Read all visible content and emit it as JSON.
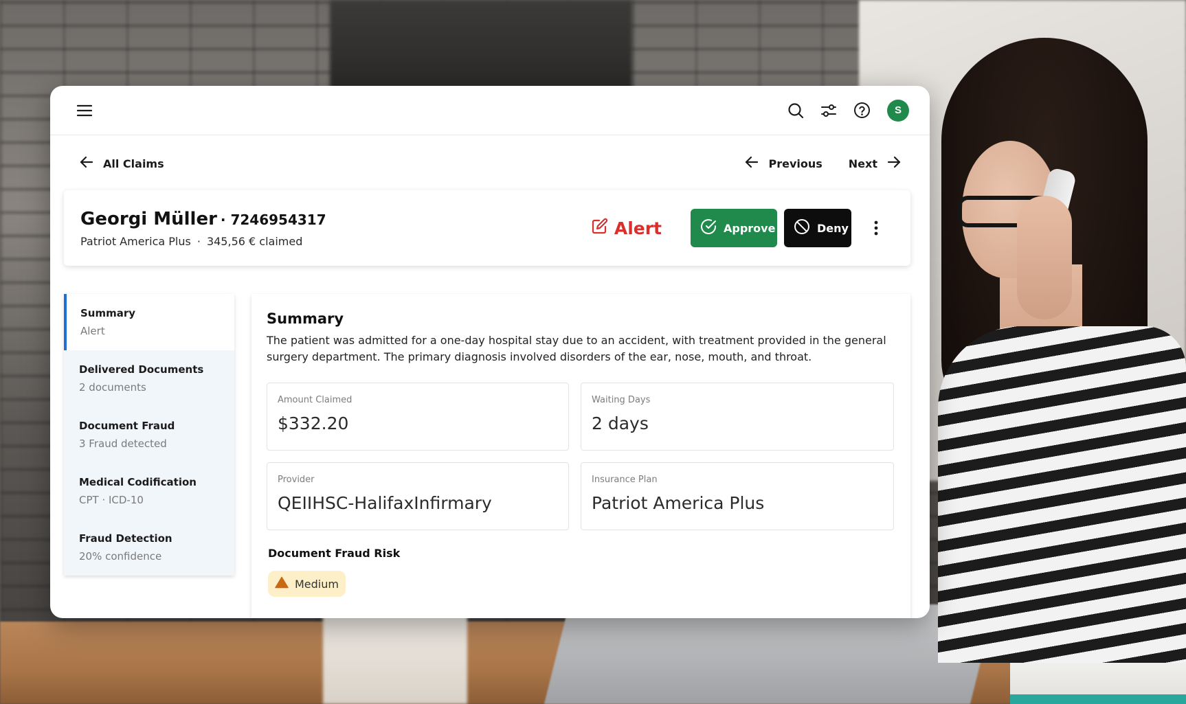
{
  "topbar": {
    "menu_icon": "menu-icon",
    "icons": [
      "search-icon",
      "filter-icon",
      "help-icon"
    ],
    "avatar_initial": "S",
    "avatar_color": "#1f8a4c"
  },
  "nav": {
    "back_label": "All Claims",
    "previous_label": "Previous",
    "next_label": "Next"
  },
  "claim": {
    "name": "Georgi Müller",
    "id": "· 7246954317",
    "plan": "Patriot America Plus",
    "separator": "·",
    "claimed": "345,56 € claimed",
    "alert_label": "Alert",
    "approve_label": "Approve",
    "deny_label": "Deny",
    "alert_color": "#d9302e",
    "approve_color": "#1f8a4c"
  },
  "sidebar": {
    "items": [
      {
        "title": "Summary",
        "subtitle": "Alert",
        "active": true
      },
      {
        "title": "Delivered Documents",
        "subtitle": "2 documents"
      },
      {
        "title": "Document Fraud",
        "subtitle": "3 Fraud detected"
      },
      {
        "title": "Medical Codification",
        "subtitle": "CPT ·  ICD-10"
      },
      {
        "title": "Fraud Detection",
        "subtitle": "20% confidence"
      }
    ]
  },
  "summary": {
    "title": "Summary",
    "description": "The patient was admitted for a one-day hospital stay due to an accident, with treatment provided in the general surgery department. The primary diagnosis involved disorders of the ear, nose, mouth, and throat.",
    "fields": [
      {
        "label": "Amount Claimed",
        "value": "$332.20"
      },
      {
        "label": "Waiting Days",
        "value": "2 days"
      },
      {
        "label": "Provider",
        "value": "QEIIHSC-HalifaxInfirmary"
      },
      {
        "label": "Insurance Plan",
        "value": "Patriot America Plus"
      }
    ],
    "risk_title": "Document Fraud Risk",
    "risk_level": "Medium",
    "risk_color": "#c96a12"
  }
}
